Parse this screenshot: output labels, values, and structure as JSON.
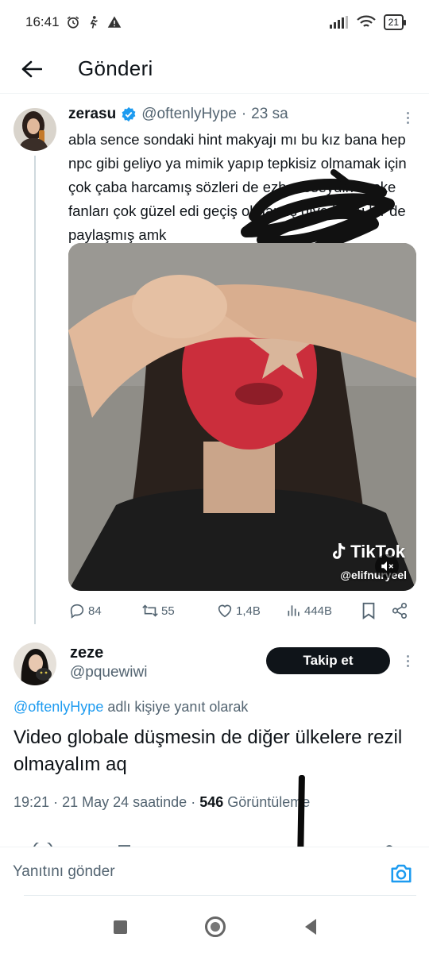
{
  "status_bar": {
    "time": "16:41",
    "battery": "21"
  },
  "header": {
    "title": "Gönderi"
  },
  "tweet": {
    "name": "zerasu",
    "handle": "@oftenlyHype",
    "time": "23 sa",
    "text": "abla sence sondaki hint makyajı mı bu kız bana hep npc gibi geliyo ya mimik yapıp tepkisiz olmamak için çok çaba harcamış sözleri de ezberleseydin keşke fanları çok güzel edi geçiş olmamış diye bunu bir de paylaşmış amk",
    "media": {
      "watermark": "TikTok",
      "watermark_user": "@elifnuryeel"
    },
    "stats": {
      "replies": "84",
      "reposts": "55",
      "likes": "1,4B",
      "views": "444B"
    }
  },
  "reply": {
    "name": "zeze",
    "handle": "@pquewiwi",
    "follow_label": "Takip et",
    "reply_to_mention": "@oftenlyHype",
    "reply_to_suffix": " adlı kişiye yanıt olarak",
    "text": "Video globale düşmesin de diğer ülkelere rezil olmayalım aq",
    "time": "19:21",
    "date": "21 May 24 saatinde",
    "views_count": "546",
    "views_label": "Görüntüleme"
  },
  "composer": {
    "placeholder": "Yanıtını gönder"
  },
  "colors": {
    "accent": "#1d9bf0",
    "text": "#0f1419",
    "muted": "#536471"
  }
}
